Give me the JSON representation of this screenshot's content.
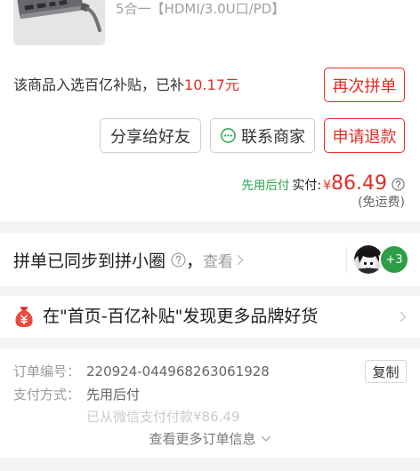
{
  "product": {
    "spec": "5合一【HDMI/3.0U口/PD】"
  },
  "subsidy": {
    "text": "该商品入选百亿补贴，已补",
    "amount": "10.17元"
  },
  "actions": {
    "reorder_label": "再次拼单",
    "share_label": "分享给好友",
    "contact_label": "联系商家",
    "refund_label": "申请退款"
  },
  "payment_summary": {
    "pay_later_label": "先用后付",
    "paid_label": "实付:",
    "currency": "¥",
    "amount": "86.49",
    "shipping_note": "(免运费)"
  },
  "group_sync": {
    "text": "拼单已同步到拼小圈",
    "comma": "，",
    "view_label": "查看",
    "more_count": "+3"
  },
  "promo": {
    "text": "在\"首页-百亿补贴\"发现更多品牌好货"
  },
  "order_info": {
    "order_no_label": "订单编号：",
    "order_no": "220924-044968263061928",
    "copy_label": "复制",
    "pay_method_label": "支付方式：",
    "pay_method": "先用后付",
    "paid_note": "已从微信支付付款¥86.49",
    "more_label": "查看更多订单信息"
  },
  "icons": {
    "product_image": "usb-hub-image",
    "contact": "chat-icon",
    "help": "help-circle-icon",
    "promo": "money-bag-icon",
    "navigate": "chevron-right-icon",
    "expand": "chevron-down-icon"
  },
  "colors": {
    "accent_red": "#e02e24",
    "accent_green": "#2aa64a",
    "badge_green": "#2f9d46",
    "separator": "#f4f4f4"
  }
}
